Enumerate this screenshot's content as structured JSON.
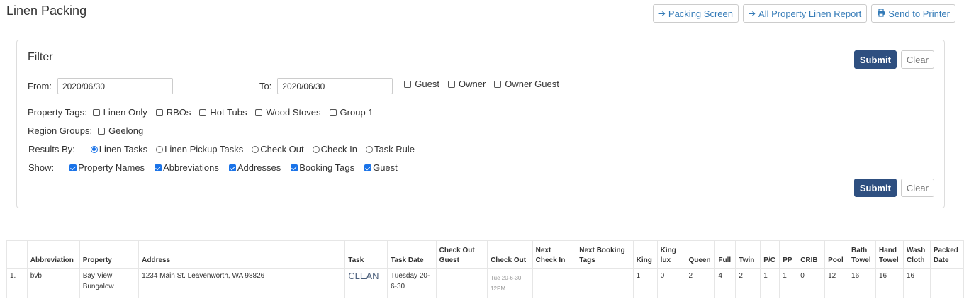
{
  "page_title": "Linen Packing",
  "top_buttons": [
    {
      "label": "Packing Screen",
      "icon": "arrow-right-icon"
    },
    {
      "label": "All Property Linen Report",
      "icon": "arrow-right-icon"
    },
    {
      "label": "Send to Printer",
      "icon": "printer-icon"
    }
  ],
  "filter": {
    "title": "Filter",
    "submit_label": "Submit",
    "clear_label": "Clear",
    "from_label": "From:",
    "from_value": "2020/06/30",
    "to_label": "To:",
    "to_value": "2020/06/30",
    "guest_types": [
      {
        "label": "Guest",
        "checked": false
      },
      {
        "label": "Owner",
        "checked": false
      },
      {
        "label": "Owner Guest",
        "checked": false
      }
    ],
    "property_tags_label": "Property Tags:",
    "property_tags": [
      {
        "label": "Linen Only",
        "checked": false
      },
      {
        "label": "RBOs",
        "checked": false
      },
      {
        "label": "Hot Tubs",
        "checked": false
      },
      {
        "label": "Wood Stoves",
        "checked": false
      },
      {
        "label": "Group 1",
        "checked": false
      }
    ],
    "region_groups_label": "Region Groups:",
    "region_groups": [
      {
        "label": "Geelong",
        "checked": false
      }
    ],
    "results_by_label": "Results By:",
    "results_by": [
      {
        "label": "Linen Tasks",
        "selected": true
      },
      {
        "label": "Linen Pickup Tasks",
        "selected": false
      },
      {
        "label": "Check Out",
        "selected": false
      },
      {
        "label": "Check In",
        "selected": false
      },
      {
        "label": "Task Rule",
        "selected": false
      }
    ],
    "show_label": "Show:",
    "show": [
      {
        "label": "Property Names",
        "checked": true
      },
      {
        "label": "Abbreviations",
        "checked": true
      },
      {
        "label": "Addresses",
        "checked": true
      },
      {
        "label": "Booking Tags",
        "checked": true
      },
      {
        "label": "Guest",
        "checked": true
      }
    ]
  },
  "table": {
    "headers": [
      "",
      "Abbreviation",
      "Property",
      "Address",
      "Task",
      "Task Date",
      "Check Out Guest",
      "Check Out",
      "Next Check In",
      "Next Booking Tags",
      "King",
      "King lux",
      "Queen",
      "Full",
      "Twin",
      "P/C",
      "PP",
      "CRIB",
      "Pool",
      "Bath Towel",
      "Hand Towel",
      "Wash Cloth",
      "Packed Date"
    ],
    "rows": [
      {
        "num": "1.",
        "abbreviation": "bvb",
        "property": "Bay View Bungalow",
        "address": "1234 Main St. Leavenworth, WA 98826",
        "task": "CLEAN",
        "task_date": "Tuesday 20-6-30",
        "check_out_guest": "",
        "check_out": "Tue 20-6-30, 12PM",
        "next_check_in": "",
        "next_booking_tags": "",
        "king": "1",
        "king_lux": "0",
        "queen": "2",
        "full": "4",
        "twin": "2",
        "pc": "1",
        "pp": "1",
        "crib": "0",
        "pool": "12",
        "bath_towel": "16",
        "hand_towel": "16",
        "wash_cloth": "16",
        "packed_date": ""
      }
    ]
  }
}
